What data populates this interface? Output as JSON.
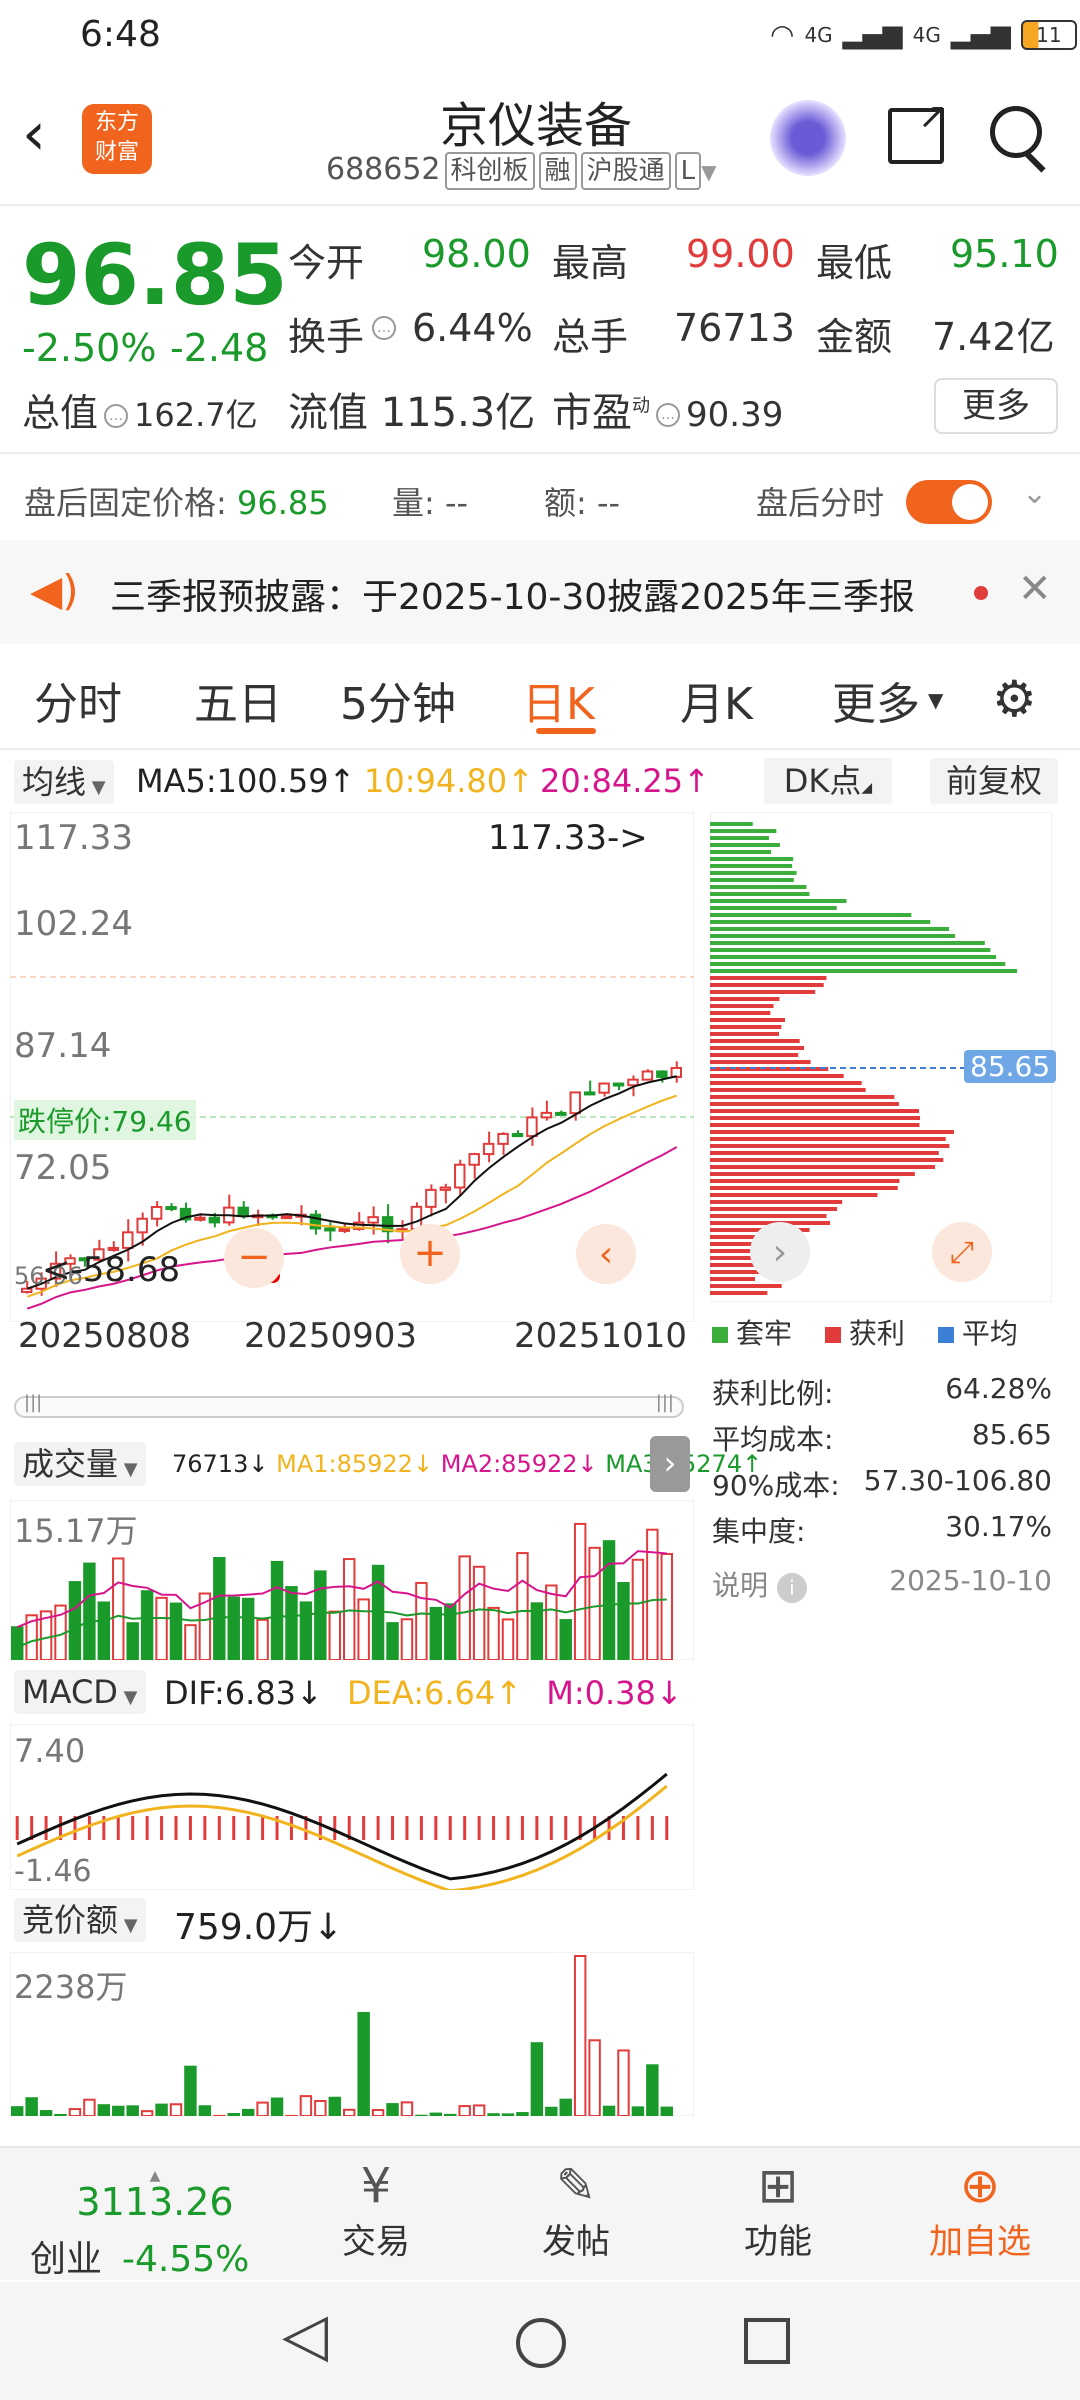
{
  "status": {
    "time": "6:48",
    "net1": "4G",
    "net2": "4G",
    "battery": "11"
  },
  "header": {
    "title": "京仪装备",
    "code": "688652",
    "tags": [
      "科创板",
      "融",
      "沪股通",
      "L"
    ],
    "logo_line1": "东方",
    "logo_line2": "财富"
  },
  "quote": {
    "price": "96.85",
    "change_pct": "-2.50%",
    "change": "-2.48",
    "open_label": "今开",
    "open": "98.00",
    "high_label": "最高",
    "high": "99.00",
    "low_label": "最低",
    "low": "95.10",
    "turnover_label": "换手",
    "turnover": "6.44%",
    "volume_label": "总手",
    "volume": "76713",
    "amount_label": "金额",
    "amount": "7.42亿",
    "mcap_label": "总值",
    "mcap": "162.7亿",
    "float_label": "流值",
    "float": "115.3亿",
    "pe_label": "市盈",
    "pe_sup": "动",
    "pe": "90.39",
    "more": "更多"
  },
  "after_hours": {
    "label": "盘后固定价格:",
    "price": "96.85",
    "vol_label": "量:",
    "vol": "--",
    "amt_label": "额:",
    "amt": "--",
    "toggle_label": "盘后分时"
  },
  "notice": {
    "text": "三季报预披露：于2025-10-30披露2025年三季报"
  },
  "tabs": [
    "分时",
    "五日",
    "5分钟",
    "日K",
    "月K",
    "更多"
  ],
  "active_tab": "日K",
  "ma": {
    "type": "均线",
    "ma5": "MA5:100.59↑",
    "ma10": "10:94.80↑",
    "ma20": "20:84.25↑",
    "dk": "DK点",
    "fq": "前复权"
  },
  "kchart": {
    "y_labels": [
      "117.33",
      "102.24",
      "87.14",
      "72.05",
      "56.96"
    ],
    "max_label": "117.33->",
    "min_label": "<-58.68",
    "limit_label": "跌停价:79.46",
    "dates": [
      "20250808",
      "20250903",
      "20251010"
    ],
    "cost_price": "85.65"
  },
  "chip": {
    "legend": [
      "套牢",
      "获利",
      "平均"
    ],
    "rows": [
      {
        "label": "获利比例:",
        "value": "64.28%"
      },
      {
        "label": "平均成本:",
        "value": "85.65"
      },
      {
        "label": "90%成本:",
        "value": "57.30-106.80"
      },
      {
        "label": "集中度:",
        "value": "30.17%"
      }
    ],
    "note": "说明",
    "date": "2025-10-10"
  },
  "vol_panel": {
    "label": "成交量",
    "v": "76713↓",
    "ma1": "MA1:85922↓",
    "ma2": "MA2:85922↓",
    "ma3": "MA3:55274↑",
    "top": "15.17万"
  },
  "macd": {
    "label": "MACD",
    "dif": "DIF:6.83↓",
    "dea": "DEA:6.64↑",
    "m": "M:0.38↓",
    "top": "7.40",
    "bottom": "-1.46"
  },
  "auction": {
    "label": "竞价额",
    "value": "759.0万↓",
    "top": "2238万"
  },
  "bottom": {
    "index_value": "3113.26",
    "index_name": "创业",
    "index_change": "-4.55%",
    "items": [
      "交易",
      "发帖",
      "功能",
      "加自选"
    ]
  },
  "colors": {
    "up": "#e23b3b",
    "down": "#1a9a2a",
    "accent": "#f0641e"
  }
}
